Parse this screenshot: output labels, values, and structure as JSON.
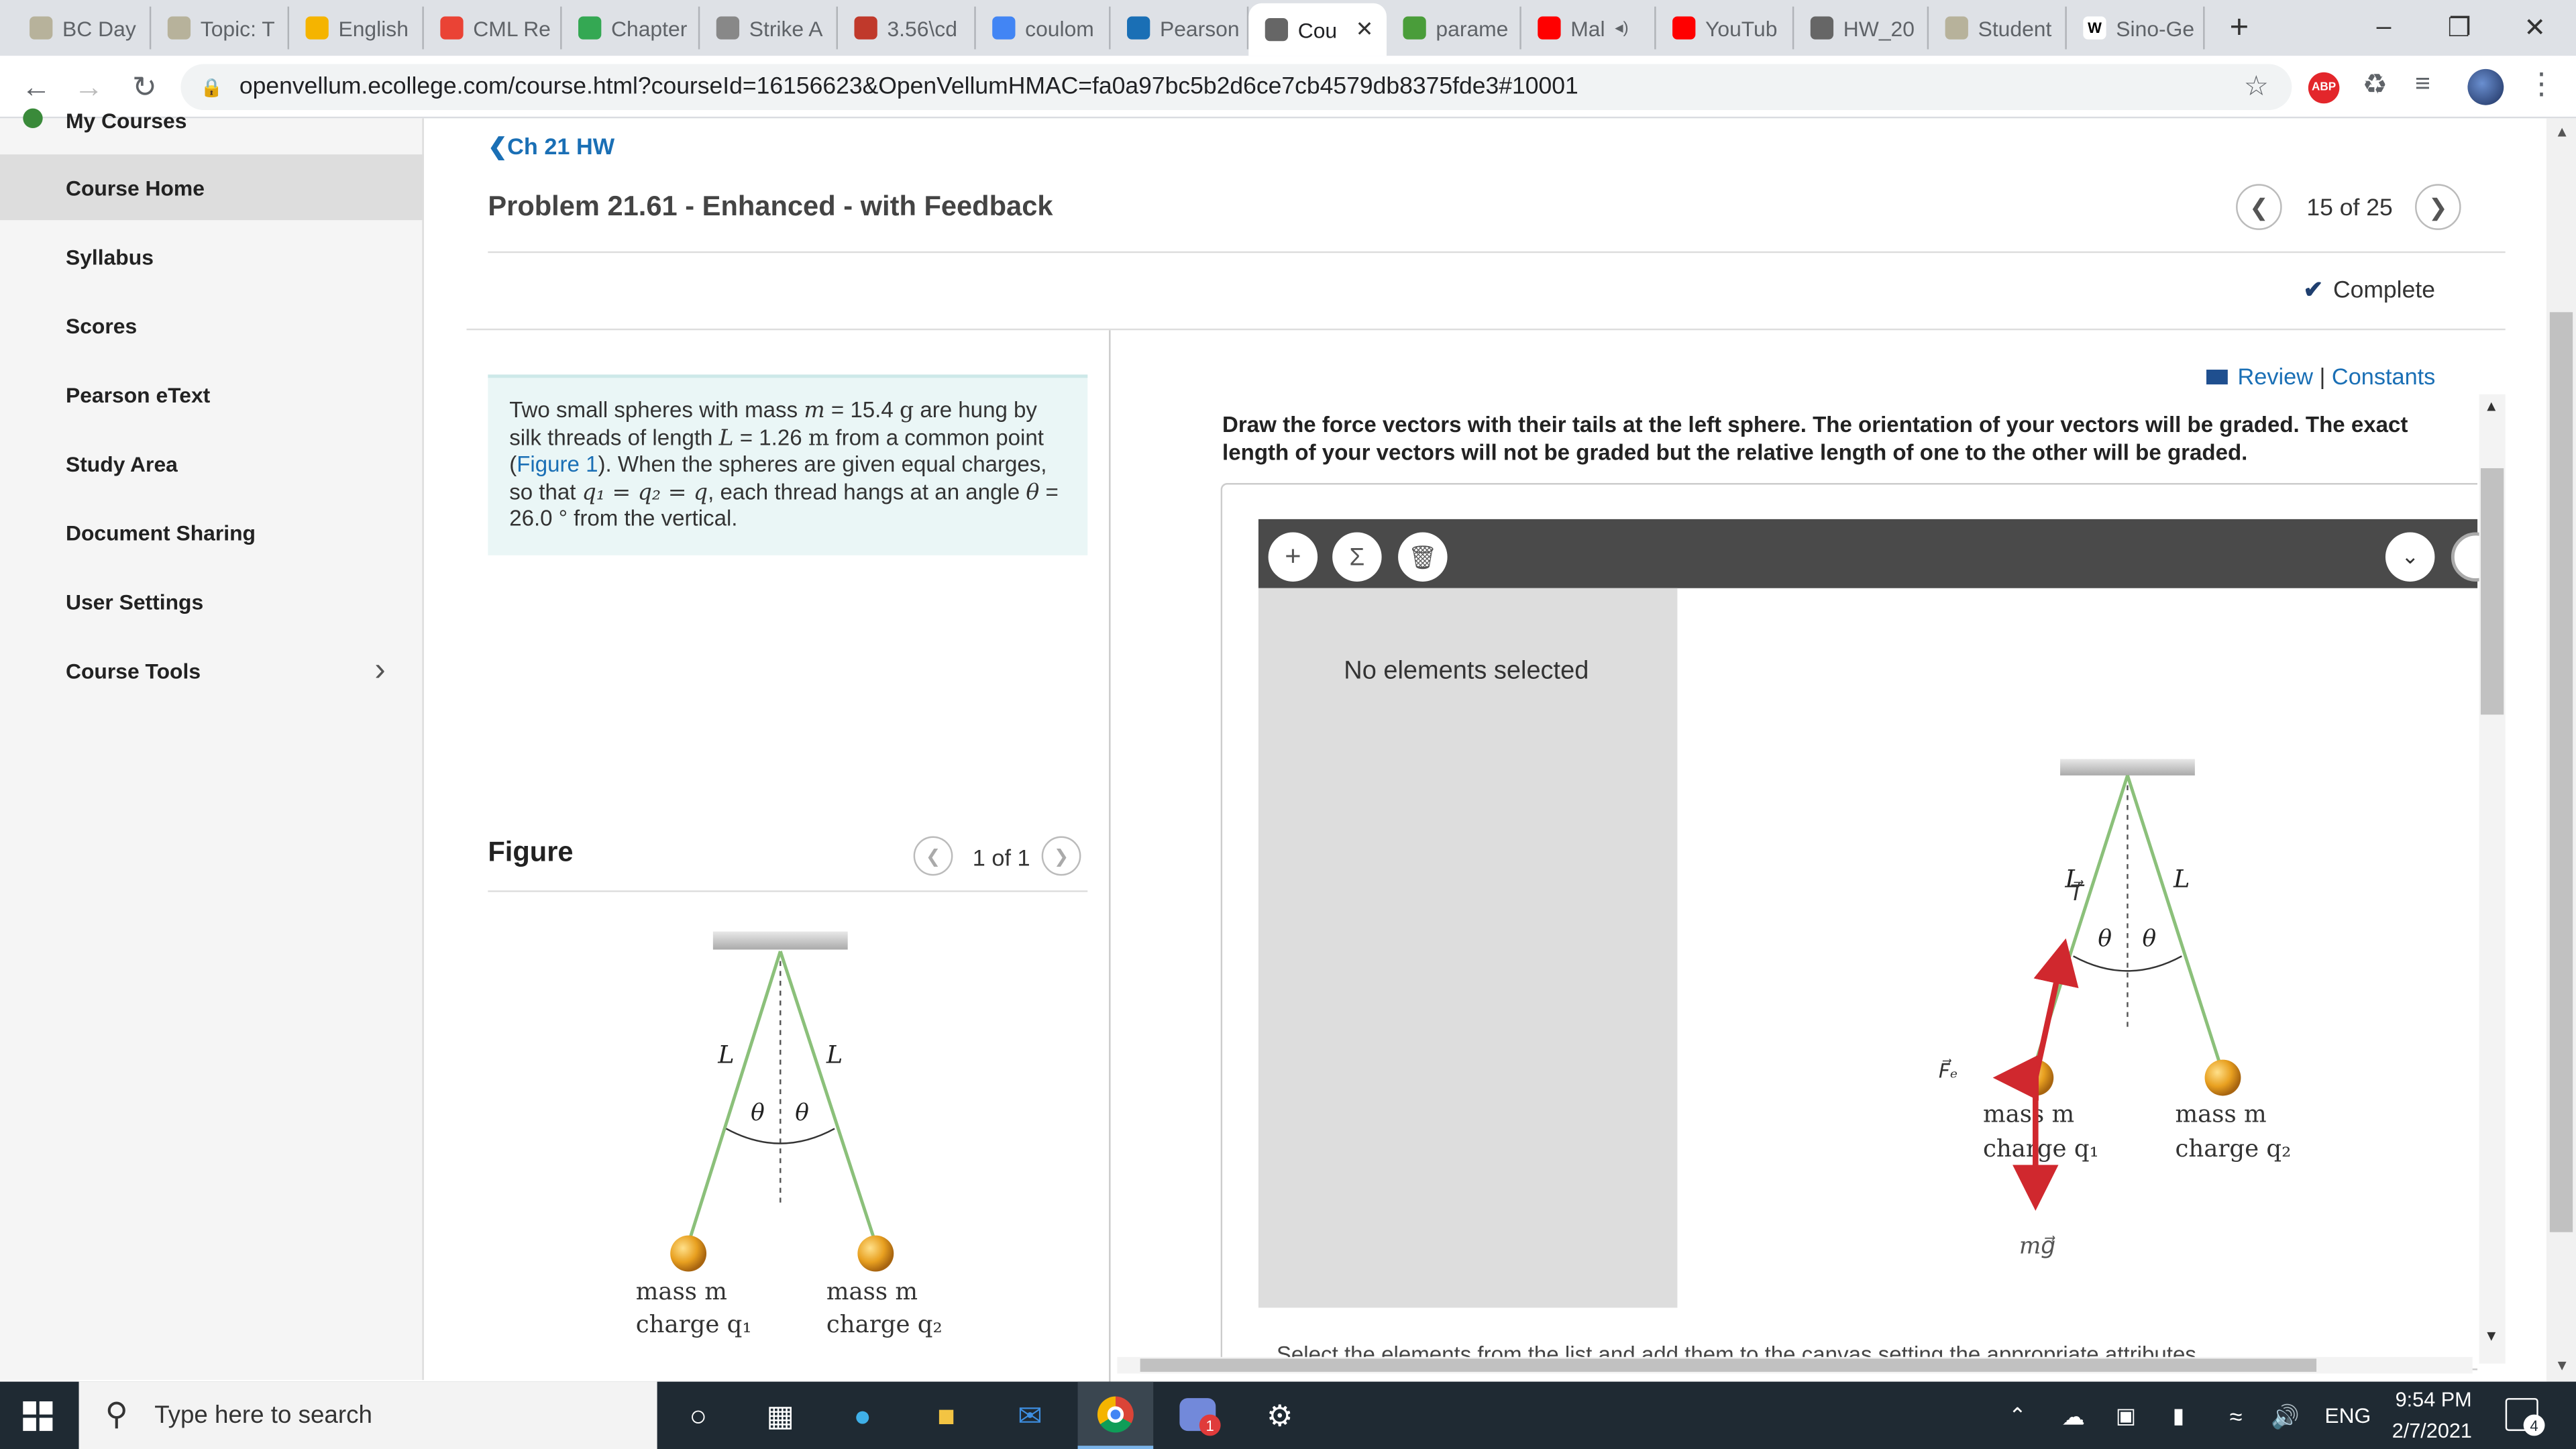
{
  "browser": {
    "tabs": [
      {
        "label": "BC Day",
        "icon": "mastering-icon"
      },
      {
        "label": "Topic: T",
        "icon": "mastering-icon"
      },
      {
        "label": "English",
        "icon": "mail-icon"
      },
      {
        "label": "CML Re",
        "icon": "gmail-icon"
      },
      {
        "label": "Chapter",
        "icon": "drive-icon"
      },
      {
        "label": "Strike A",
        "icon": "image-icon"
      },
      {
        "label": "3.56\\cd",
        "icon": "sy-icon"
      },
      {
        "label": "coulom",
        "icon": "google-icon"
      },
      {
        "label": "Pearson",
        "icon": "pearson-icon"
      },
      {
        "label": "Cou",
        "icon": "page-icon"
      },
      {
        "label": "parame",
        "icon": "wolfram-icon"
      },
      {
        "label": "Mal",
        "icon": "youtube-icon"
      },
      {
        "label": "YouTub",
        "icon": "youtube-icon"
      },
      {
        "label": "HW_20",
        "icon": "globe-icon"
      },
      {
        "label": "Student",
        "icon": "mastering-icon"
      },
      {
        "label": "Sino-Ge",
        "icon": "wikipedia-icon"
      }
    ],
    "active_tab_index": 9,
    "url": "openvellum.ecollege.com/course.html?courseId=16156623&OpenVellumHMAC=fa0a97bc5b2d6ce7cb4579db8375fde3#10001",
    "abp_label": "ABP"
  },
  "sidebar": {
    "partial_item": "My Courses",
    "items": [
      {
        "label": "Course Home"
      },
      {
        "label": "Syllabus"
      },
      {
        "label": "Scores"
      },
      {
        "label": "Pearson eText"
      },
      {
        "label": "Study Area"
      },
      {
        "label": "Document Sharing"
      },
      {
        "label": "User Settings"
      },
      {
        "label": "Course Tools"
      }
    ],
    "active_index": 0
  },
  "problem": {
    "back_link": "Ch 21 HW",
    "title": "Problem 21.61 - Enhanced - with Feedback",
    "pager": "15 of 25",
    "status": "Complete",
    "review": "Review",
    "constants": "Constants",
    "text_1": "Two small spheres with mass ",
    "m_sym": "m",
    "text_2": " = 15.4 ",
    "g_unit": "g",
    "text_3": " are hung by silk threads of length ",
    "L_sym": "L",
    "text_4": " = 1.26 ",
    "m_unit": "m",
    "text_5": " from a common point (",
    "figure_link": "Figure 1",
    "text_6": "). When the spheres are given equal charges, so that ",
    "q_eq": "q₁ = q₂ = q",
    "text_7": ", each thread hangs at an angle ",
    "theta_sym": "θ",
    "text_8": " = 26.0 ° from the vertical.",
    "instructions": "Draw the force vectors with their tails at the left sphere. The orientation of your vectors will be graded. The exact length of your vectors will not be graded but the relative length of one to the other will be graded.",
    "no_selection": "No elements selected",
    "footer_text": "Select the elements from the list and add them to the canvas setting the appropriate attributes."
  },
  "figure": {
    "heading": "Figure",
    "pager": "1 of 1",
    "L_label": "L",
    "theta": "θ",
    "mass_label": "mass m",
    "charge_left": "charge q₁",
    "charge_right": "charge q₂"
  },
  "canvas": {
    "fe_label": "F⃗ₑ",
    "T_label": "T⃗",
    "mg_label": "mg⃗",
    "arrow_color": "#d0282e"
  },
  "taskbar": {
    "search_placeholder": "Type here to search",
    "language": "ENG",
    "time": "9:54 PM",
    "date": "2/7/2021",
    "notification_count": "4",
    "discord_badge": "1"
  },
  "colors": {
    "link": "#1a6fb5",
    "thread": "#8bc07a",
    "sphere": "#e8a020"
  }
}
